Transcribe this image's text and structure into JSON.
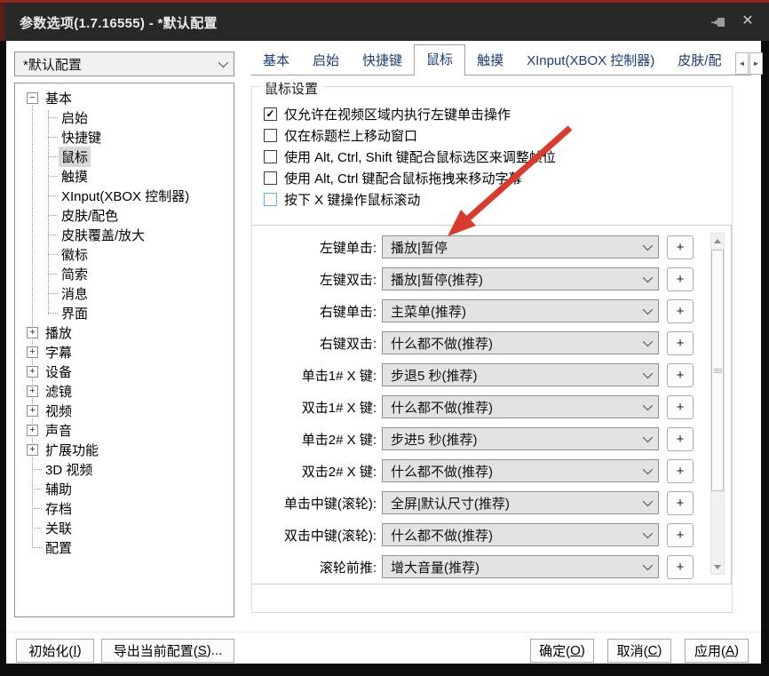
{
  "titlebar": {
    "title": "参数选项(1.7.16555) - *默认配置",
    "close_glyph": "✕"
  },
  "profile": {
    "value": "*默认配置"
  },
  "tabs": {
    "items": [
      "基本",
      "启始",
      "快捷键",
      "鼠标",
      "触摸",
      "XInput(XBOX 控制器)",
      "皮肤/配"
    ],
    "active_index": 3,
    "scroll_left_glyph": "◄",
    "scroll_right_glyph": "►"
  },
  "tree": {
    "items": [
      {
        "label": "基本",
        "level": 0,
        "expander": "minus"
      },
      {
        "label": "启始",
        "level": 1
      },
      {
        "label": "快捷键",
        "level": 1
      },
      {
        "label": "鼠标",
        "level": 1,
        "selected": true
      },
      {
        "label": "触摸",
        "level": 1
      },
      {
        "label": "XInput(XBOX 控制器)",
        "level": 1
      },
      {
        "label": "皮肤/配色",
        "level": 1
      },
      {
        "label": "皮肤覆盖/放大",
        "level": 1
      },
      {
        "label": "徽标",
        "level": 1
      },
      {
        "label": "简索",
        "level": 1
      },
      {
        "label": "消息",
        "level": 1
      },
      {
        "label": "界面",
        "level": 1
      },
      {
        "label": "播放",
        "level": 0,
        "expander": "plus"
      },
      {
        "label": "字幕",
        "level": 0,
        "expander": "plus"
      },
      {
        "label": "设备",
        "level": 0,
        "expander": "plus"
      },
      {
        "label": "滤镜",
        "level": 0,
        "expander": "plus"
      },
      {
        "label": "视频",
        "level": 0,
        "expander": "plus"
      },
      {
        "label": "声音",
        "level": 0,
        "expander": "plus"
      },
      {
        "label": "扩展功能",
        "level": 0,
        "expander": "plus"
      },
      {
        "label": "3D 视频",
        "level": 0
      },
      {
        "label": "辅助",
        "level": 0
      },
      {
        "label": "存档",
        "level": 0
      },
      {
        "label": "关联",
        "level": 0
      },
      {
        "label": "配置",
        "level": 0
      }
    ],
    "collapse_glyph": "−",
    "expand_glyph": "+"
  },
  "mouse_panel": {
    "group_title": "鼠标设置",
    "check_glyph": "✓",
    "checkboxes": [
      {
        "label": "仅允许在视频区域内执行左键单击操作",
        "checked": true,
        "focused": false
      },
      {
        "label": "仅在标题栏上移动窗口",
        "checked": false,
        "focused": false
      },
      {
        "label": "使用 Alt, Ctrl, Shift 键配合鼠标选区来调整帧位",
        "checked": false,
        "focused": false
      },
      {
        "label": "使用 Alt, Ctrl 键配合鼠标拖拽来移动字幕",
        "checked": false,
        "focused": false
      },
      {
        "label": "按下 X 键操作鼠标滚动",
        "checked": false,
        "focused": true
      }
    ],
    "add_button_glyph": "+",
    "rows": [
      {
        "label": "左键单击:",
        "value": "播放|暂停"
      },
      {
        "label": "左键双击:",
        "value": "播放|暂停(推荐)"
      },
      {
        "label": "右键单击:",
        "value": "主菜单(推荐)"
      },
      {
        "label": "右键双击:",
        "value": "什么都不做(推荐)"
      },
      {
        "label": "单击1# X 键:",
        "value": "步退5 秒(推荐)"
      },
      {
        "label": "双击1# X 键:",
        "value": "什么都不做(推荐)"
      },
      {
        "label": "单击2# X 键:",
        "value": "步进5 秒(推荐)"
      },
      {
        "label": "双击2# X 键:",
        "value": "什么都不做(推荐)"
      },
      {
        "label": "单击中键(滚轮):",
        "value": "全屏|默认尺寸(推荐)"
      },
      {
        "label": "双击中键(滚轮):",
        "value": "什么都不做(推荐)"
      },
      {
        "label": "滚轮前推:",
        "value": "增大音量(推荐)"
      }
    ]
  },
  "footer": {
    "left_buttons": [
      {
        "pre": "初始化(",
        "key": "I",
        "suf": ")"
      },
      {
        "pre": "导出当前配置(",
        "key": "S",
        "suf": ")..."
      }
    ],
    "right_buttons": [
      {
        "pre": "确定(",
        "key": "O",
        "suf": ")"
      },
      {
        "pre": "取消(",
        "key": "C",
        "suf": ")"
      },
      {
        "pre": "应用(",
        "key": "A",
        "suf": ")"
      }
    ]
  },
  "colors": {
    "accent_red": "#d93a2e",
    "title_bg": "#282828",
    "focus_blue": "#5fb2e0"
  }
}
